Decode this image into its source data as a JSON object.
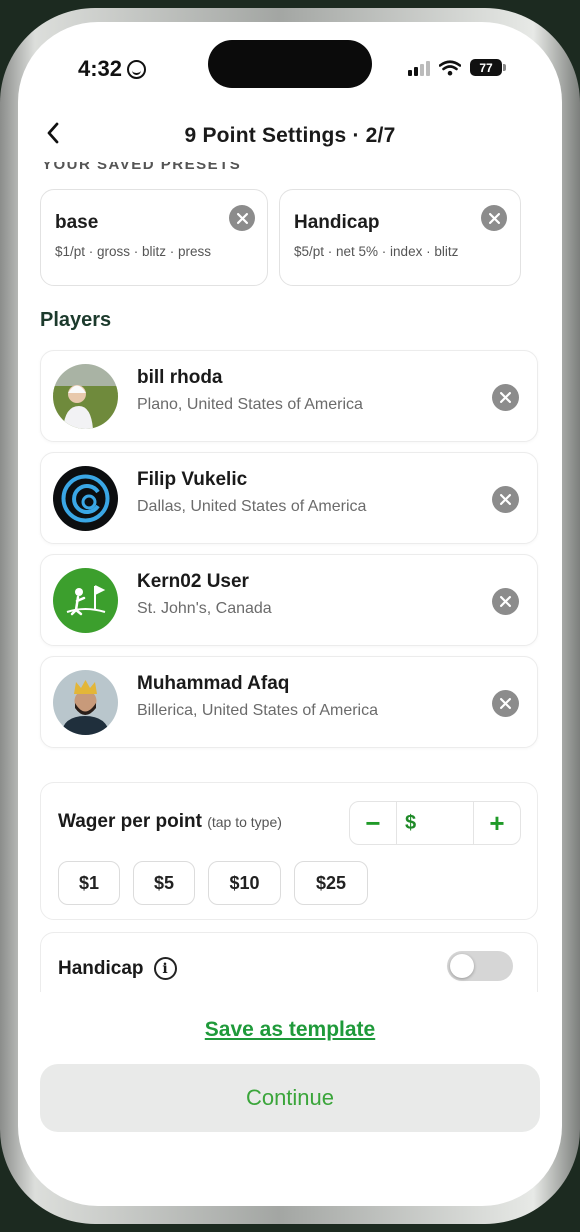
{
  "status_bar": {
    "time": "4:32",
    "battery": "77"
  },
  "header": {
    "title": "9 Point Settings · 2/7"
  },
  "presets": {
    "section_label": "YOUR SAVED PRESETS",
    "items": [
      {
        "name": "base",
        "desc": "$1/pt · gross · blitz · press"
      },
      {
        "name": "Handicap",
        "desc": "$5/pt · net 5% · index · blitz"
      }
    ]
  },
  "players": {
    "heading": "Players",
    "items": [
      {
        "name": "bill rhoda",
        "location": "Plano, United States of America"
      },
      {
        "name": "Filip Vukelic",
        "location": "Dallas, United States of America"
      },
      {
        "name": "Kern02 User",
        "location": "St. John's, Canada"
      },
      {
        "name": "Muhammad Afaq",
        "location": "Billerica, United States of America"
      }
    ]
  },
  "wager": {
    "label": "Wager per point",
    "hint": "(tap to type)",
    "minus": "−",
    "plus": "+",
    "currency": "$",
    "chips": [
      "$1",
      "$5",
      "$10",
      "$25"
    ]
  },
  "handicap": {
    "label": "Handicap",
    "info": "i",
    "enabled": false
  },
  "footer": {
    "save_template": "Save as template",
    "continue": "Continue"
  },
  "colors": {
    "accent": "#1f9a28",
    "primary_text": "#1a1a1a",
    "button_bg": "#e9eae9"
  }
}
